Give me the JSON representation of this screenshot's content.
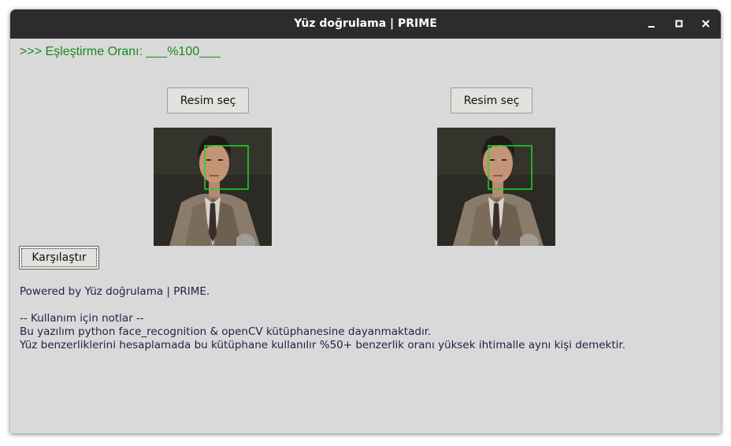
{
  "window": {
    "title": "Yüz doğrulama | PRIME"
  },
  "match": {
    "ratio_label": ">>> Eşleştirme Oranı: ___%100___"
  },
  "buttons": {
    "pick_left": "Resim seç",
    "pick_right": "Resim seç",
    "compare": "Karşılaştır"
  },
  "colors": {
    "ratio_text": "#1a8a1a",
    "face_box": "#1ed81e",
    "titlebar": "#2c2c2c",
    "window_bg": "#d9d9d9"
  },
  "icons": {
    "minimize": "minimize-icon",
    "maximize": "maximize-icon",
    "close": "close-icon"
  },
  "info": {
    "powered_by": "Powered by Yüz doğrulama | PRIME.",
    "notes_header": "-- Kullanım için notlar --",
    "note_1": "Bu yazılım python face_recognition & openCV kütüphanesine dayanmaktadır.",
    "note_2": "Yüz benzerliklerini hesaplamada bu kütüphane kullanılır %50+ benzerlik oranı yüksek ihtimalle aynı kişi demektir."
  }
}
